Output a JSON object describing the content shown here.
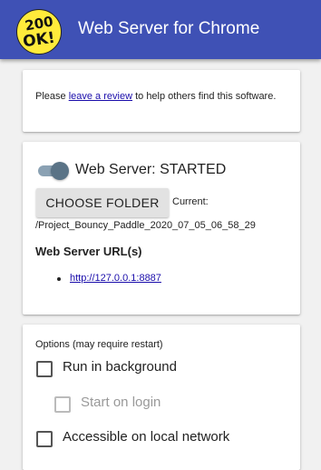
{
  "header": {
    "logo_line1": "200",
    "logo_line2": "OK!",
    "title": "Web Server for Chrome"
  },
  "review_card": {
    "prefix": "Please ",
    "link_text": "leave a review",
    "suffix": " to help others find this software."
  },
  "server_card": {
    "toggle_on": true,
    "status_text": "Web Server: STARTED",
    "choose_folder_label": "CHOOSE FOLDER",
    "current_label": "Current:",
    "current_path": "/Project_Bouncy_Paddle_2020_07_05_06_58_29",
    "urls_heading": "Web Server URL(s)",
    "urls": [
      "http://127.0.0.1:8887"
    ]
  },
  "options_card": {
    "heading": "Options (may require restart)",
    "options": [
      {
        "label": "Run in background",
        "checked": false,
        "enabled": true
      },
      {
        "label": "Start on login",
        "checked": false,
        "enabled": false
      },
      {
        "label": "Accessible on local network",
        "checked": false,
        "enabled": true
      }
    ]
  },
  "colors": {
    "header_bg": "#3f51b5",
    "logo_bg": "#ffeb3b",
    "toggle_knob": "#5a7386",
    "link": "#1a0dab"
  }
}
